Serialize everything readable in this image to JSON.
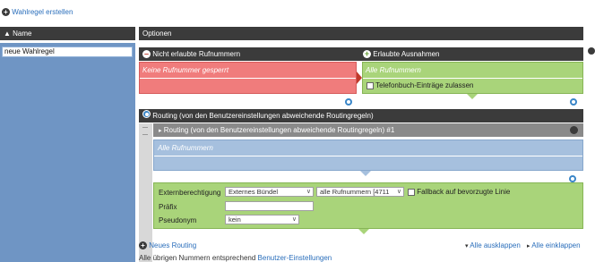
{
  "top_link": "Wahlregel erstellen",
  "left_header": "Name",
  "rule_name_value": "neue Wahlregel",
  "options_header": "Optionen",
  "blocked_header": "Nicht erlaubte Rufnummern",
  "allowed_header": "Erlaubte Ausnahmen",
  "blocked_text": "Keine Rufnummer gesperrt",
  "allowed_text": "Alle Rufnummern",
  "phonebook_label": "Telefonbuch-Einträge zulassen",
  "routing_header": "Routing (von den Benutzereinstellungen abweichende Routingregeln)",
  "routing_sub_header": "Routing (von den Benutzereinstellungen abweichende Routingregeln) #1",
  "routing_numbers_text": "Alle Rufnummern",
  "form": {
    "ext_label": "Externberechtigung",
    "ext_value": "Externes Bündel",
    "numbers_value": "alle Rufnummern [4711",
    "fallback_label": "Fallback auf bevorzugte Linie",
    "prefix_label": "Präfix",
    "prefix_value": "",
    "pseudonym_label": "Pseudonym",
    "pseudonym_value": "kein"
  },
  "new_routing_link": "Neues Routing",
  "expand_all": "Alle ausklappen",
  "collapse_all": "Alle einklappen",
  "footer_text": "Alle übrigen Nummern entsprechend",
  "footer_link": "Benutzer-Einstellungen",
  "colors": {
    "dark_header": "#3b3b3b",
    "blue_panel": "#6f95c4",
    "blocked_red": "#f07c7c",
    "allowed_green": "#a9d47a",
    "routing_blue": "#a6c0de"
  }
}
